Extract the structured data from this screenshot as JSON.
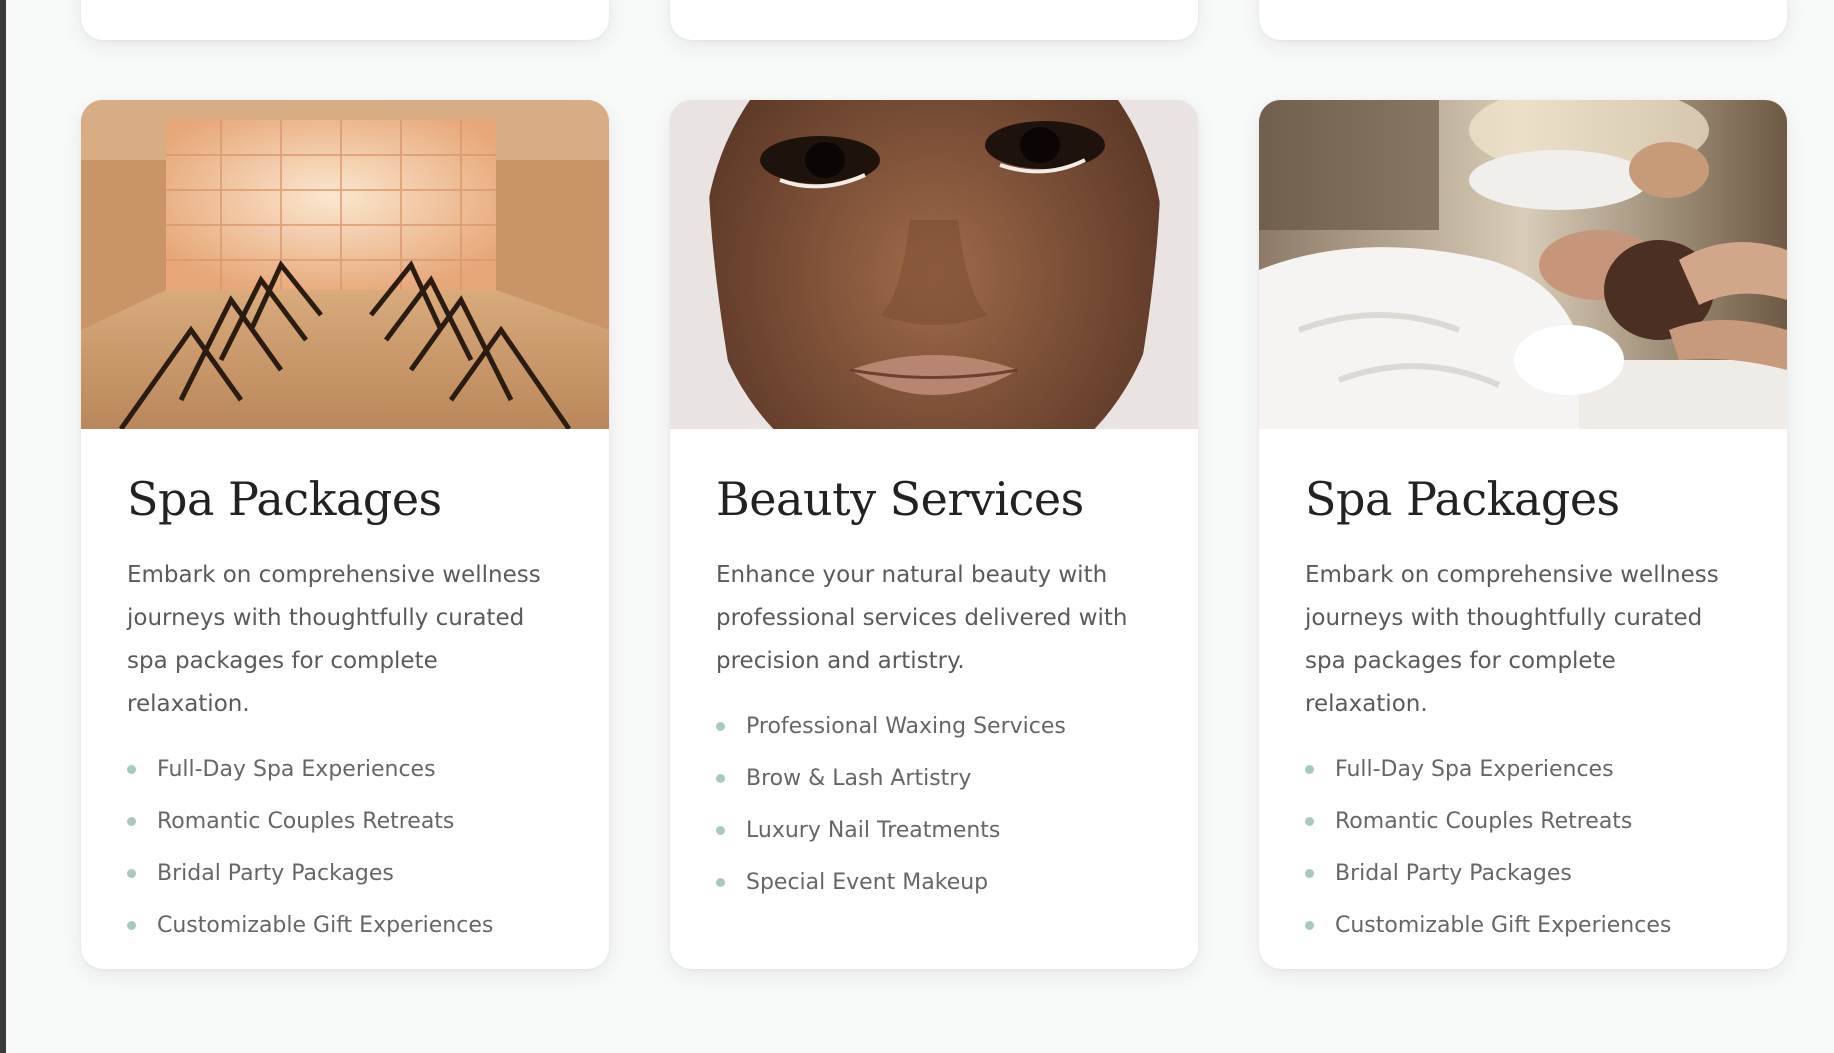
{
  "cards": [
    {
      "image": "salt-room-with-lounge-chairs",
      "title": "Spa Packages",
      "description": "Embark on comprehensive wellness journeys with thoughtfully curated spa packages for complete relaxation.",
      "features": [
        "Full-Day Spa Experiences",
        "Romantic Couples Retreats",
        "Bridal Party Packages",
        "Customizable Gift Experiences"
      ]
    },
    {
      "image": "woman-face-makeup-closeup",
      "title": "Beauty Services",
      "description": "Enhance your natural beauty with professional services delivered with precision and artistry.",
      "features": [
        "Professional Waxing Services",
        "Brow & Lash Artistry",
        "Luxury Nail Treatments",
        "Special Event Makeup"
      ]
    },
    {
      "image": "couple-head-massage-spa",
      "title": "Spa Packages",
      "description": "Embark on comprehensive wellness journeys with thoughtfully curated spa packages for complete relaxation.",
      "features": [
        "Full-Day Spa Experiences",
        "Romantic Couples Retreats",
        "Bridal Party Packages",
        "Customizable Gift Experiences"
      ]
    }
  ],
  "colors": {
    "page_background": "#f8f9f9",
    "card_background": "#ffffff",
    "title": "#222222",
    "body_text": "#5a5a5a",
    "bullet": "#a9c9bf"
  }
}
